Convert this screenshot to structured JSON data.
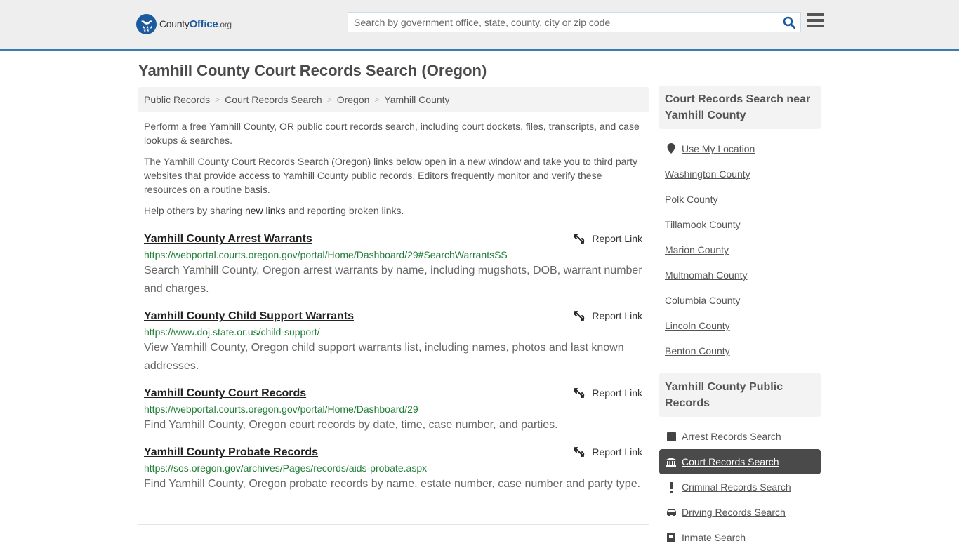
{
  "header": {
    "logo": {
      "name_plain": "County",
      "name_bold": "Office",
      "tld": ".org"
    },
    "search": {
      "placeholder": "Search by government office, state, county, city or zip code",
      "value": ""
    },
    "icons": {
      "search": "search-icon",
      "menu": "hamburger-menu-icon"
    }
  },
  "page": {
    "title": "Yamhill County Court Records Search (Oregon)"
  },
  "breadcrumb": [
    {
      "label": "Public Records"
    },
    {
      "label": "Court Records Search"
    },
    {
      "label": "Oregon"
    },
    {
      "label": "Yamhill County"
    }
  ],
  "intro": {
    "p1": "Perform a free Yamhill County, OR public court records search, including court dockets, files, transcripts, and case lookups & searches.",
    "p2": "The Yamhill County Court Records Search (Oregon) links below open in a new window and take you to third party websites that provide access to Yamhill County public records. Editors frequently monitor and verify these resources on a routine basis.",
    "p3_before": "Help others by sharing ",
    "p3_link": "new links",
    "p3_after": " and reporting broken links."
  },
  "results": [
    {
      "title": "Yamhill County Arrest Warrants",
      "url": "https://webportal.courts.oregon.gov/portal/Home/Dashboard/29#SearchWarrantsSS",
      "description": "Search Yamhill County, Oregon arrest warrants by name, including mugshots, DOB, warrant number and charges.",
      "report_label": "Report Link"
    },
    {
      "title": "Yamhill County Child Support Warrants",
      "url": "https://www.doj.state.or.us/child-support/",
      "description": "View Yamhill County, Oregon child support warrants list, including names, photos and last known addresses.",
      "report_label": "Report Link"
    },
    {
      "title": "Yamhill County Court Records",
      "url": "https://webportal.courts.oregon.gov/portal/Home/Dashboard/29",
      "description": "Find Yamhill County, Oregon court records by date, time, case number, and parties.",
      "report_label": "Report Link"
    },
    {
      "title": "Yamhill County Probate Records",
      "url": "https://sos.oregon.gov/archives/Pages/records/aids-probate.aspx",
      "description": "Find Yamhill County, Oregon probate records by name, estate number, case number and party type.",
      "report_label": "Report Link"
    }
  ],
  "sidebar": {
    "nearby": {
      "heading": "Court Records Search near Yamhill County",
      "use_location": "Use My Location",
      "counties": [
        "Washington County",
        "Polk County",
        "Tillamook County",
        "Marion County",
        "Multnomah County",
        "Columbia County",
        "Lincoln County",
        "Benton County"
      ]
    },
    "public_records": {
      "heading": "Yamhill County Public Records",
      "items": [
        {
          "label": "Arrest Records Search",
          "icon": "square-icon",
          "active": false
        },
        {
          "label": "Court Records Search",
          "icon": "courthouse-icon",
          "active": true
        },
        {
          "label": "Criminal Records Search",
          "icon": "exclamation-icon",
          "active": false
        },
        {
          "label": "Driving Records Search",
          "icon": "car-icon",
          "active": false
        },
        {
          "label": "Inmate Search",
          "icon": "inmate-icon",
          "active": false
        }
      ]
    }
  },
  "colors": {
    "brand_blue": "#1c5a9e",
    "header_border": "#3a7bb0",
    "url_green": "#1e7e34",
    "active_bg": "#4a4a4a"
  }
}
